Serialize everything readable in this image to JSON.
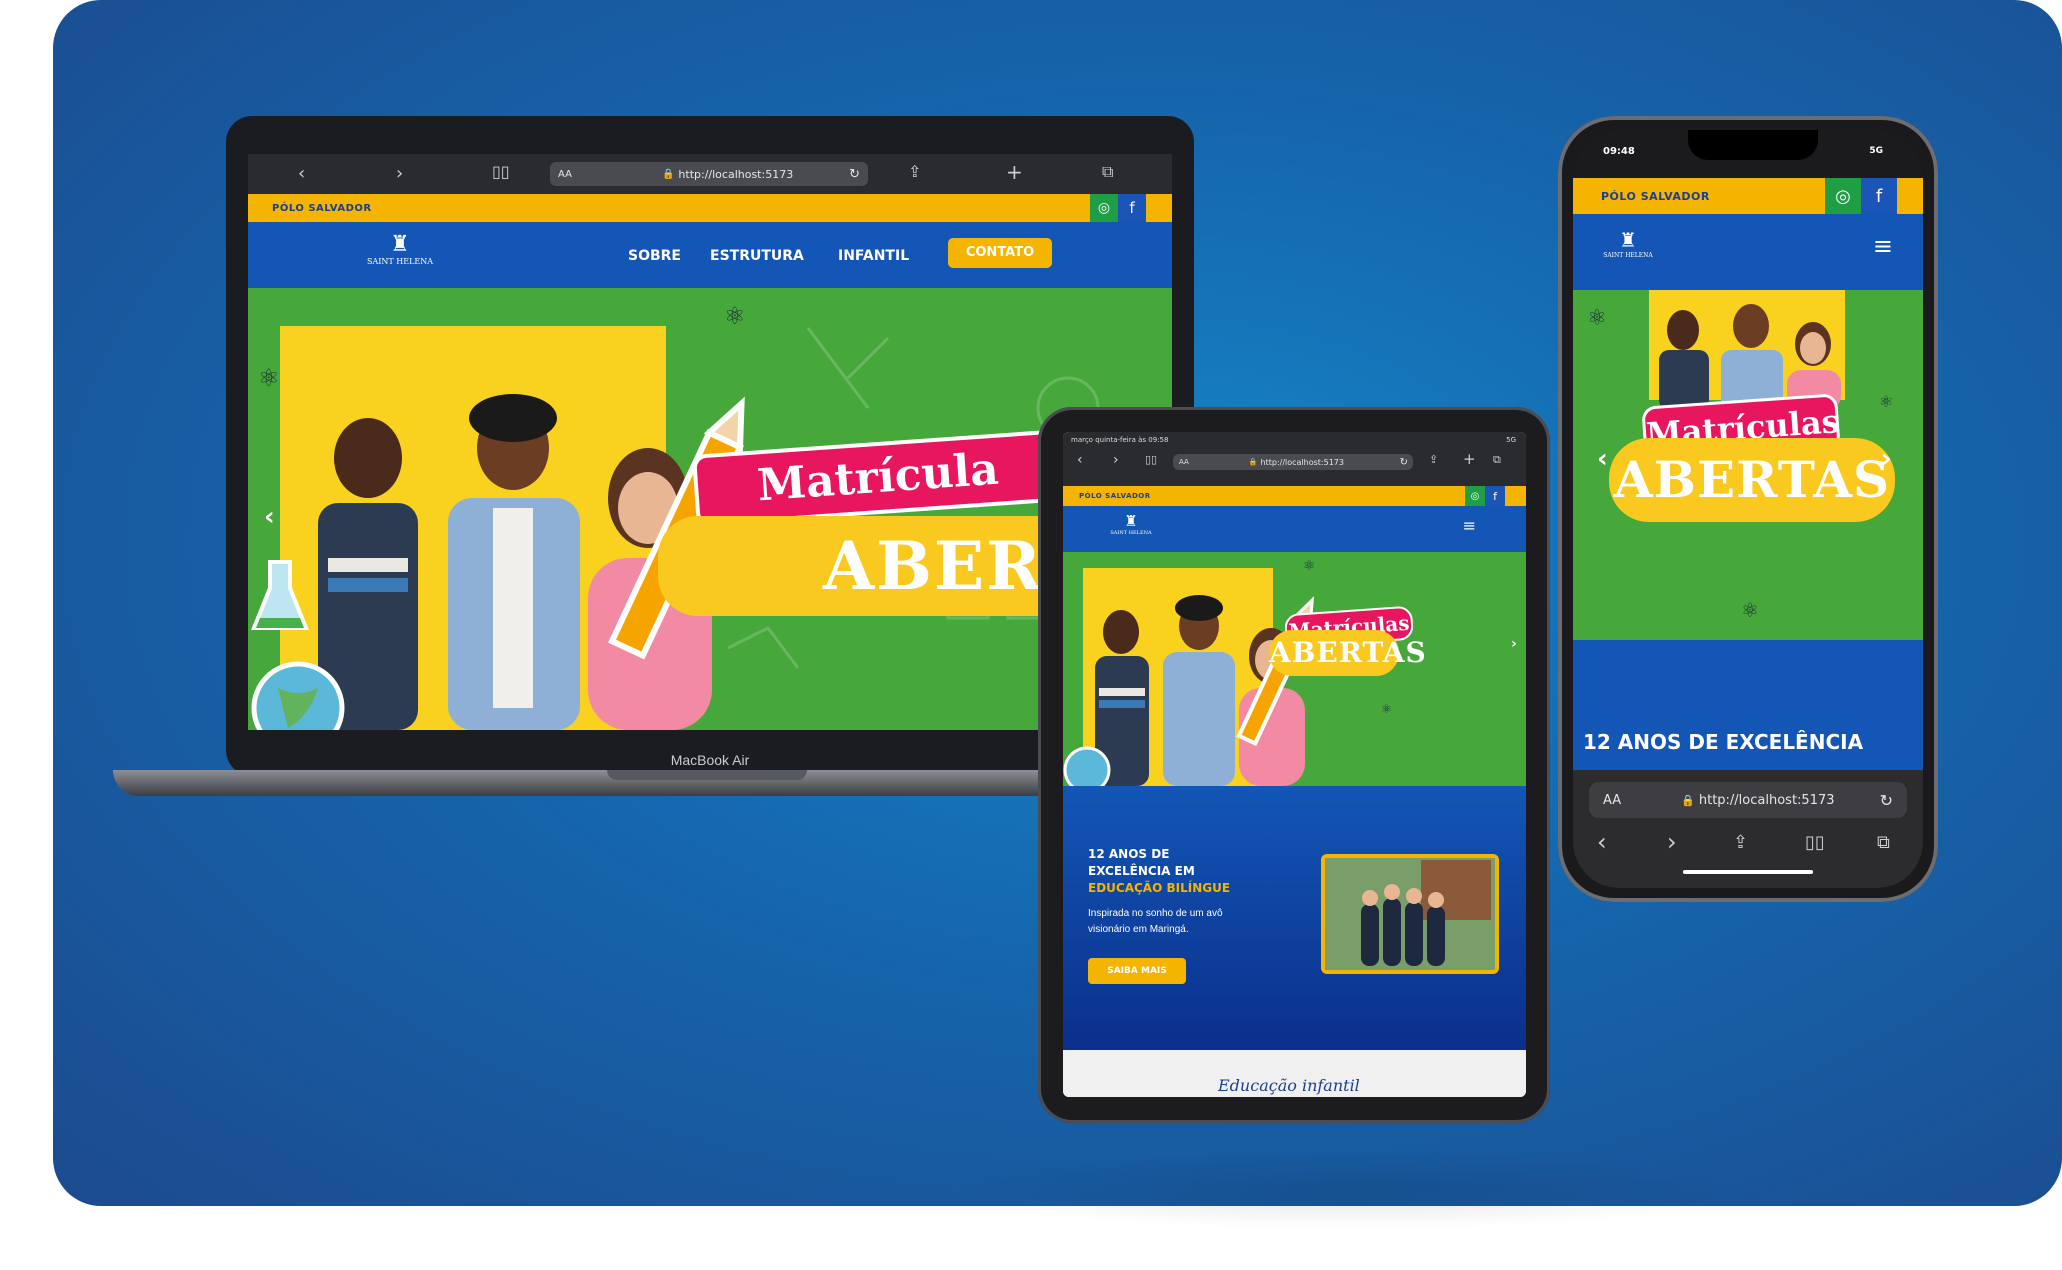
{
  "colors": {
    "brand_blue": "#1356b5",
    "brand_yellow": "#f4b400",
    "hero_green": "#46a83a",
    "tag_pink": "#e8155f",
    "background_blue": "#1566ad"
  },
  "site": {
    "polo": "Pólo Salvador",
    "logo_name": "SAINT HELENA",
    "nav": {
      "sobre": "SOBRE",
      "estrutura": "ESTRUTURA",
      "infantil": "INFANTIL",
      "contato": "CONTATO"
    },
    "hero": {
      "tag_line1": "Matrícula",
      "tag_line1_full": "Matrículas",
      "tag_line2_partial": "ABERT",
      "tag_line2": "ABERTAS"
    },
    "about": {
      "line1": "12 ANOS DE",
      "line2": "EXCELÊNCIA EM",
      "line3": "EDUCAÇÃO BILÍNGUE",
      "desc_line1": "Inspirada no sonho de um avô",
      "desc_line2": "visionário em Maringá.",
      "button": "SAIBA MAIS"
    },
    "phone_heading": "12 ANOS DE EXCELÊNCIA",
    "infantil_heading": "Educação infantil"
  },
  "laptop": {
    "url": "http://localhost:5173",
    "aa": "AA",
    "device_label": "MacBook Air"
  },
  "tablet": {
    "status_time": "março quinta-feira às 09:58",
    "status_right": "5G",
    "url": "http://localhost:5173",
    "aa": "AA"
  },
  "phone": {
    "time": "09:48",
    "signal": "5G",
    "url": "http://localhost:5173",
    "aa": "AA"
  },
  "icons": [
    "chevron-left-icon",
    "chevron-right-icon",
    "book-icon",
    "lock-icon",
    "reload-icon",
    "share-icon",
    "plus-icon",
    "tabs-icon",
    "instagram-icon",
    "facebook-icon",
    "menu-icon",
    "atom-icon"
  ]
}
